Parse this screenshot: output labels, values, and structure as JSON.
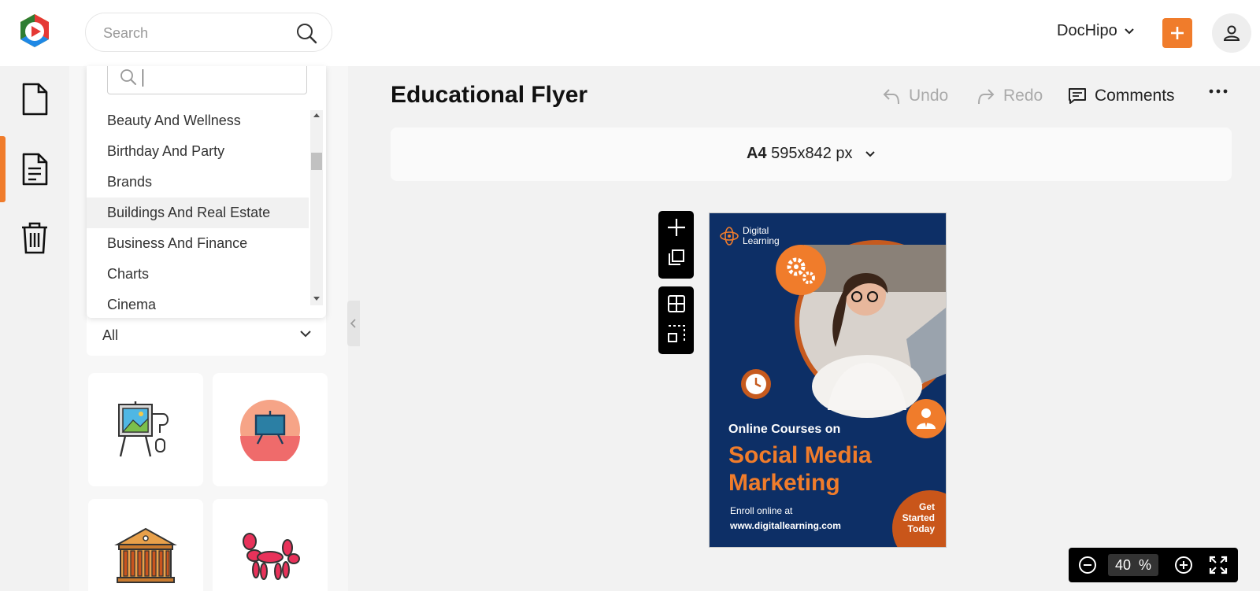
{
  "header": {
    "search_placeholder": "Search",
    "account_name": "DocHipo"
  },
  "panel": {
    "category_search_value": "",
    "categories": [
      "Beauty And Wellness",
      "Birthday And Party",
      "Brands",
      "Buildings And Real Estate",
      "Business And Finance",
      "Charts",
      "Cinema"
    ],
    "highlighted_category": "Buildings And Real Estate",
    "filter_value": "All"
  },
  "editor": {
    "title": "Educational Flyer",
    "undo_label": "Undo",
    "redo_label": "Redo",
    "comments_label": "Comments",
    "page_size_name": "A4",
    "page_size_dims": "595x842 px"
  },
  "flyer": {
    "brand_line1": "Digital",
    "brand_line2": "Learning",
    "heading": "Online Courses on",
    "big_line1": "Social Media",
    "big_line2": "Marketing",
    "enroll": "Enroll online at",
    "url": "www.digitallearning.com",
    "cta_line1": "Get",
    "cta_line2": "Started",
    "cta_line3": "Today"
  },
  "zoom": {
    "value": "40",
    "unit": "%"
  },
  "colors": {
    "accent": "#f07c2b",
    "flyer_bg": "#0d2f66"
  }
}
